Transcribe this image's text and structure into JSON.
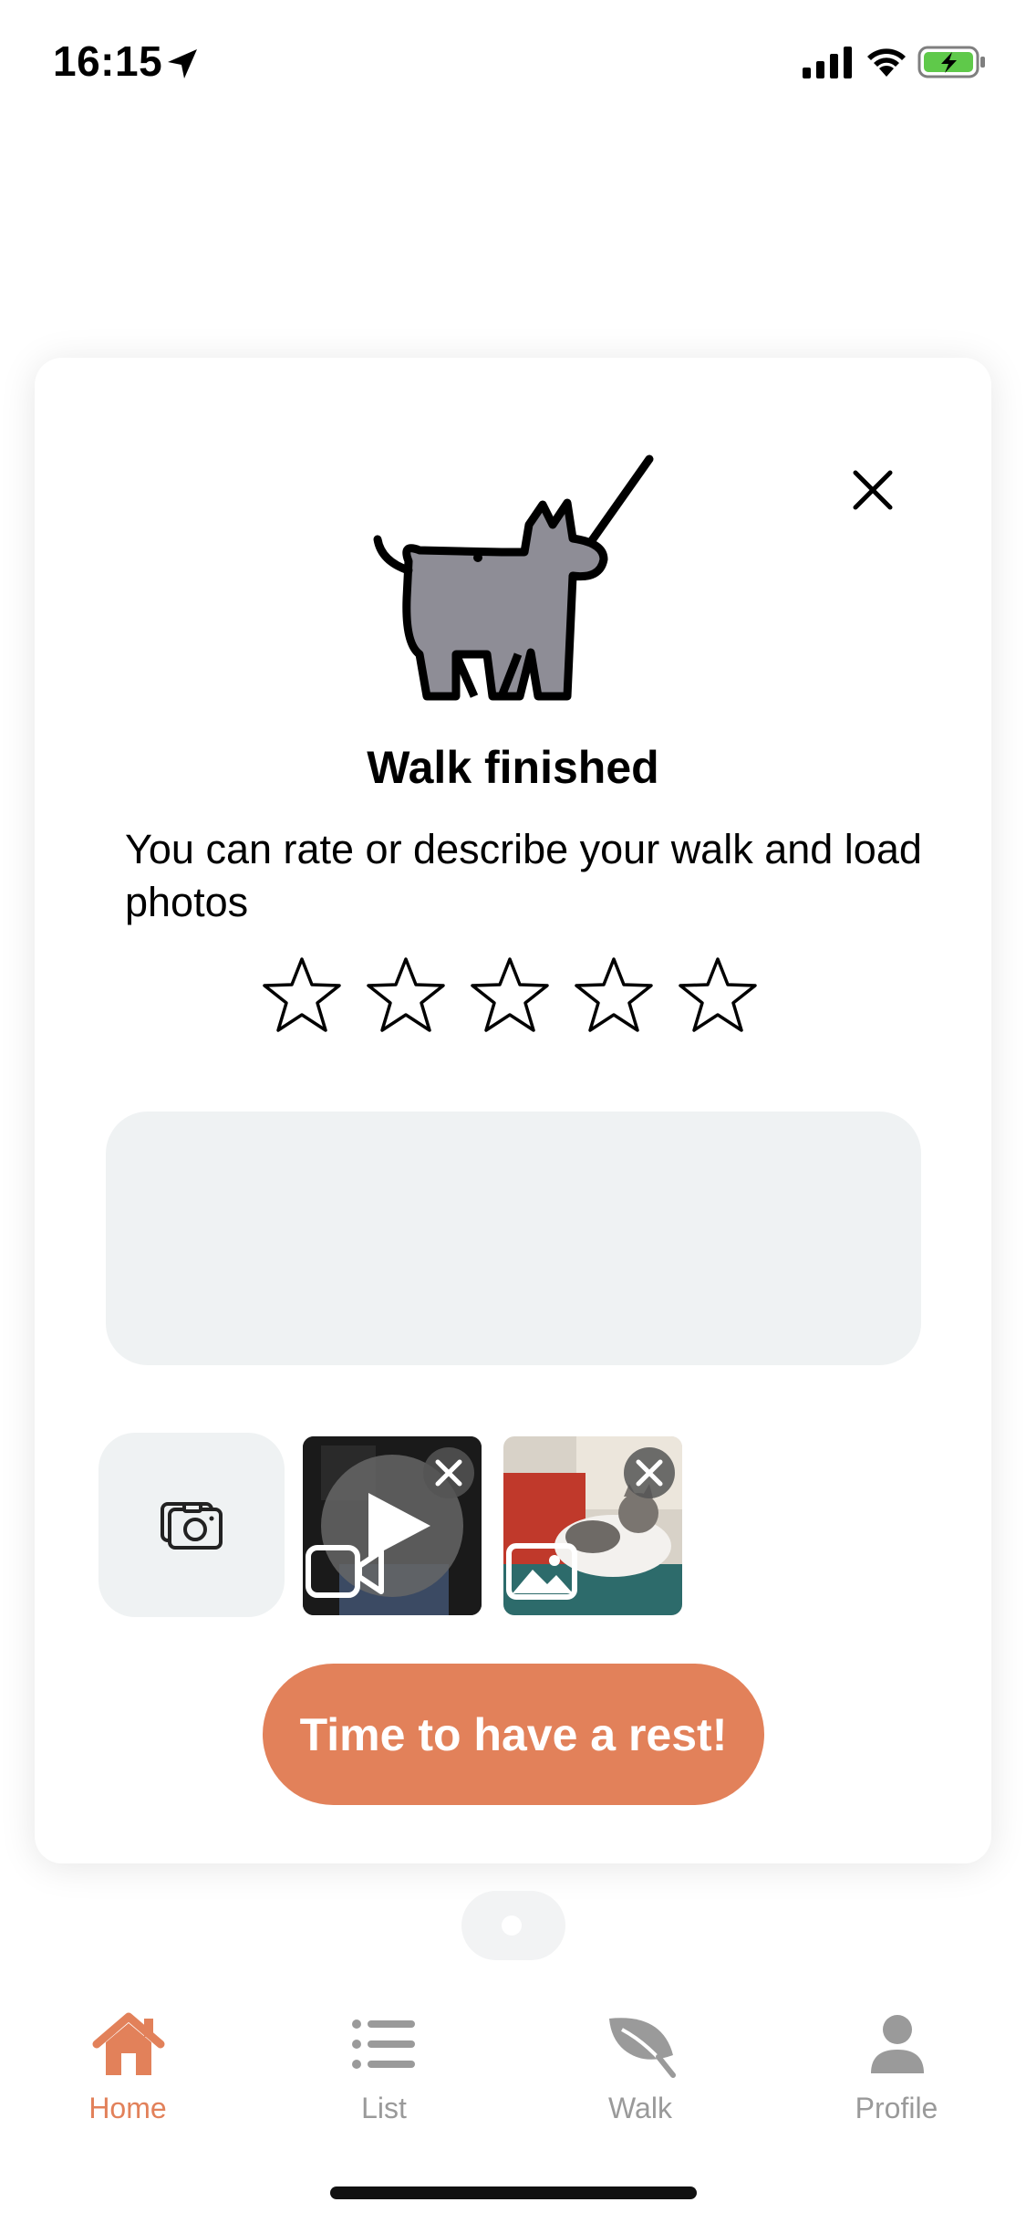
{
  "status_bar": {
    "time": "16:15"
  },
  "modal": {
    "title": "Walk finished",
    "subtitle": "You can rate or describe your walk and load photos",
    "rating": {
      "value": 0,
      "max": 5
    },
    "description": {
      "value": "",
      "placeholder": ""
    },
    "primary_button_label": "Time to have a rest!"
  },
  "media": [
    {
      "type": "video",
      "icon": "video-camera-icon"
    },
    {
      "type": "photo",
      "icon": "image-icon"
    }
  ],
  "tab_bar": {
    "items": [
      {
        "label": "Home",
        "icon": "home-icon",
        "active": true
      },
      {
        "label": "List",
        "icon": "list-icon",
        "active": false
      },
      {
        "label": "Walk",
        "icon": "leaf-icon",
        "active": false
      },
      {
        "label": "Profile",
        "icon": "person-icon",
        "active": false
      }
    ]
  },
  "colors": {
    "accent": "#e2815a",
    "inactive": "#9a9a9a",
    "field_bg": "#eff2f3",
    "battery_green": "#5fc94a"
  }
}
